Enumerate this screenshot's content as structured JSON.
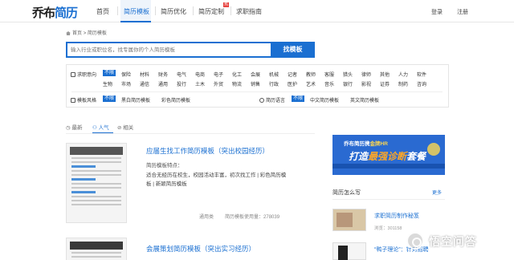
{
  "header": {
    "logo_part1": "乔布",
    "logo_part2": "简历",
    "nav": [
      "首页",
      "简历模板",
      "简历优化",
      "简历定制",
      "求职指南"
    ],
    "hot_badge": "热",
    "login": "登录",
    "register": "注册"
  },
  "breadcrumb": {
    "home": "首页",
    "sep": ">",
    "current": "简历模板"
  },
  "search": {
    "placeholder": "输入行业或职位名，找专属你的个人简历模板",
    "button": "找模板"
  },
  "filters": {
    "job_label": "求职意向",
    "unlimited": "不限",
    "row1": [
      "保险",
      "材料",
      "财务",
      "电气",
      "电商",
      "电子",
      "化工",
      "会展",
      "机械",
      "记者",
      "教师",
      "客服",
      "猎头",
      "律师",
      "其他",
      "人力",
      "软件"
    ],
    "row2": [
      "生物",
      "市场",
      "通信",
      "通用",
      "投行",
      "土木",
      "外贸",
      "物流",
      "销售",
      "行政",
      "医护",
      "艺术",
      "音乐",
      "银行",
      "影视",
      "证券",
      "制药",
      "咨询"
    ],
    "style_label": "模板风格",
    "style_options": [
      "黑白简历模板",
      "彩色简历模板"
    ],
    "lang_label": "简历语言",
    "lang_options": [
      "中文简历模板",
      "英文简历模板"
    ]
  },
  "sort_tabs": [
    "最新",
    "人气",
    "相关"
  ],
  "listings": [
    {
      "title": "应届生找工作简历模板（突出校园经历）",
      "subtitle": "简历模板特点：",
      "desc": "适合无经历在校生，校园活动丰富，初次找工作 | 彩色简历模板 | 新颖简历模板",
      "category": "通用类",
      "usage_label": "简历模板使用量：",
      "usage": "278039"
    },
    {
      "title": "会展策划简历模板（突出实习经历）"
    }
  ],
  "sidebar": {
    "banner_top_a": "乔布简历携",
    "banner_top_b": "金牌HR",
    "banner_main_a": "打造",
    "banner_main_b": "最强诊断",
    "banner_main_c": "套餐",
    "section_title": "简历怎么写",
    "more": "更多",
    "articles": [
      {
        "title": "求职简历制作秘笈",
        "views_label": "浏览：",
        "views": "301158"
      },
      {
        "title": "“鸭子理论”：针对招聘",
        "views_label": "",
        "views": ""
      }
    ]
  },
  "watermark": "悟空问答",
  "colors": {
    "primary": "#1a6fd1",
    "badge_red": "#e53935",
    "banner_blue": "#2a6ad1"
  }
}
